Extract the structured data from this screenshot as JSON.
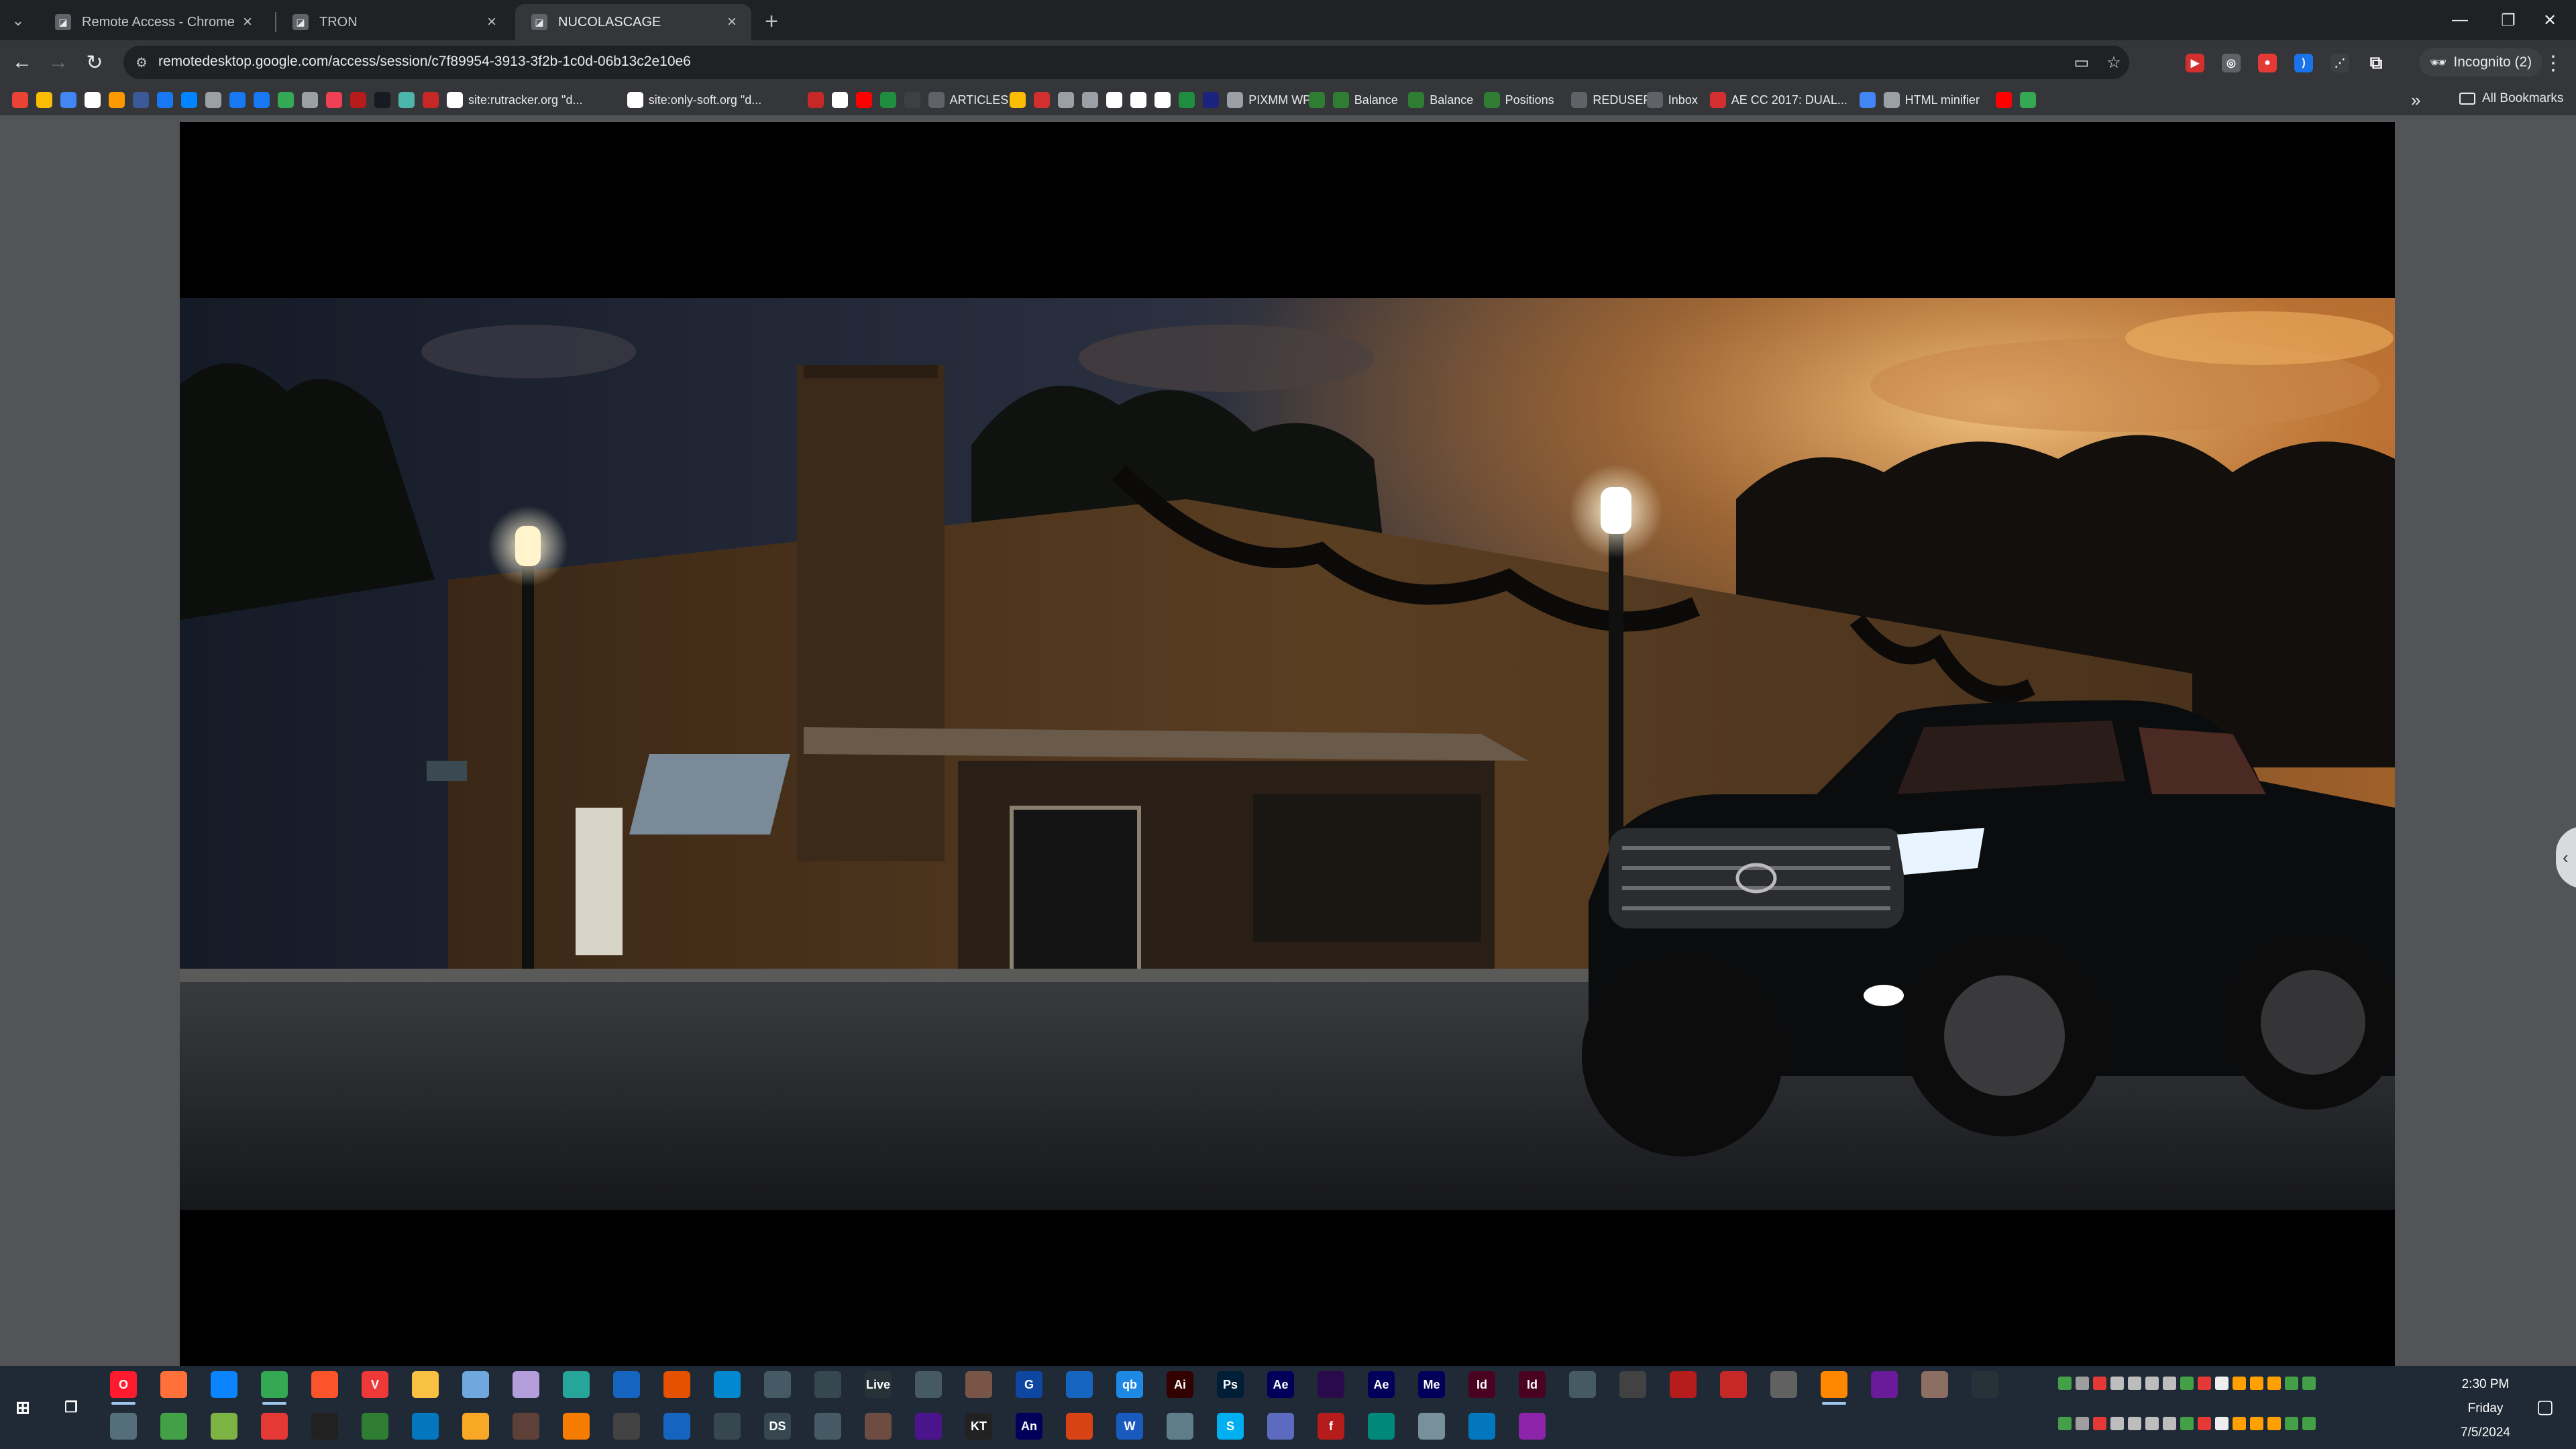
{
  "browser": {
    "tabs": [
      {
        "title": "Remote Access - Chrome Remo",
        "active": false
      },
      {
        "title": "TRON",
        "active": false
      },
      {
        "title": "NUCOLASCAGE",
        "active": true
      }
    ],
    "url": "remotedesktop.google.com/access/session/c7f89954-3913-3f2b-1c0d-06b13c2e10e6",
    "incognito_label": "Incognito (2)",
    "bookmarks": [
      {
        "icon": "gmail-icon",
        "label": "",
        "color": "#ea4335"
      },
      {
        "icon": "apps-icon",
        "label": "",
        "color": "#fbbc04"
      },
      {
        "icon": "globe-icon",
        "label": "",
        "color": "#4285f4"
      },
      {
        "icon": "amazon-icon",
        "label": "",
        "color": "#ffffff"
      },
      {
        "icon": "amazon-icon",
        "label": "",
        "color": "#ff9900"
      },
      {
        "icon": "h-icon",
        "label": "",
        "color": "#3b5998"
      },
      {
        "icon": "facebook-icon",
        "label": "",
        "color": "#1877f2"
      },
      {
        "icon": "messenger-icon",
        "label": "",
        "color": "#0084ff"
      },
      {
        "icon": "page-icon",
        "label": "",
        "color": "#9aa0a6"
      },
      {
        "icon": "facebook-icon",
        "label": "",
        "color": "#1877f2"
      },
      {
        "icon": "facebook-icon",
        "label": "",
        "color": "#1877f2"
      },
      {
        "icon": "chrome-icon",
        "label": "",
        "color": "#34a853"
      },
      {
        "icon": "globe-icon",
        "label": "",
        "color": "#9aa0a6"
      },
      {
        "icon": "pocket-icon",
        "label": "",
        "color": "#ef4056"
      },
      {
        "icon": "red-icon",
        "label": "",
        "color": "#b71c1c"
      },
      {
        "icon": "steam-icon",
        "label": "",
        "color": "#171a21"
      },
      {
        "icon": "circle-icon",
        "label": "",
        "color": "#4db6ac"
      },
      {
        "icon": "red-icon",
        "label": "",
        "color": "#c62828"
      },
      {
        "icon": "google-icon",
        "label": "site:rutracker.org \"d...",
        "color": "#ffffff"
      },
      {
        "icon": "google-icon",
        "label": "site:only-soft.org \"d...",
        "color": "#ffffff"
      },
      {
        "icon": "red-icon",
        "label": "",
        "color": "#c62828"
      },
      {
        "icon": "google-icon",
        "label": "",
        "color": "#ffffff"
      },
      {
        "icon": "youtube-icon",
        "label": "",
        "color": "#ff0000"
      },
      {
        "icon": "fl-icon",
        "label": "",
        "color": "#1e8e3e"
      },
      {
        "icon": "i-icon",
        "label": "",
        "color": "#3c4043"
      },
      {
        "icon": "articles-icon",
        "label": "ARTICLES",
        "color": "#5f6368"
      },
      {
        "icon": "color-icon",
        "label": "",
        "color": "#fbbc04"
      },
      {
        "icon": "n-icon",
        "label": "",
        "color": "#d32f2f"
      },
      {
        "icon": "page-icon",
        "label": "",
        "color": "#9aa0a6"
      },
      {
        "icon": "page-icon",
        "label": "",
        "color": "#9aa0a6"
      },
      {
        "icon": "google-icon",
        "label": "",
        "color": "#ffffff"
      },
      {
        "icon": "google-icon",
        "label": "",
        "color": "#ffffff"
      },
      {
        "icon": "google-icon",
        "label": "",
        "color": "#ffffff"
      },
      {
        "icon": "green-icon",
        "label": "",
        "color": "#1e8e3e"
      },
      {
        "icon": "ha-icon",
        "label": "",
        "color": "#1a237e"
      },
      {
        "icon": "globe-icon",
        "label": "PIXMM WP",
        "color": "#9aa0a6"
      },
      {
        "icon": "td-icon",
        "label": "",
        "color": "#2e7d32"
      },
      {
        "icon": "td-icon",
        "label": "Balance",
        "color": "#2e7d32"
      },
      {
        "icon": "td-icon",
        "label": "Balance",
        "color": "#2e7d32"
      },
      {
        "icon": "td-icon",
        "label": "Positions",
        "color": "#2e7d32"
      },
      {
        "icon": "page-icon",
        "label": "REDUSER",
        "color": "#5f6368"
      },
      {
        "icon": "page-icon",
        "label": "Inbox",
        "color": "#5f6368"
      },
      {
        "icon": "adobe-icon",
        "label": "AE CC 2017: DUAL...",
        "color": "#d32f2f"
      },
      {
        "icon": "info-icon",
        "label": "",
        "color": "#4285f4"
      },
      {
        "icon": "globe-icon",
        "label": "HTML minifier",
        "color": "#9aa0a6"
      },
      {
        "icon": "youtube-icon",
        "label": "",
        "color": "#ff0000"
      },
      {
        "icon": "maps-icon",
        "label": "",
        "color": "#34a853"
      }
    ],
    "all_bookmarks_label": "All Bookmarks"
  },
  "taskbar": {
    "time": "2:30 PM",
    "day": "Friday",
    "date": "7/5/2024",
    "row1_apps": [
      {
        "name": "opera",
        "label": "O",
        "color": "#ff1b2d"
      },
      {
        "name": "firefox",
        "label": "",
        "color": "#ff7139"
      },
      {
        "name": "firefox-dev",
        "label": "",
        "color": "#0a84ff"
      },
      {
        "name": "chrome",
        "label": "",
        "color": "#34a853"
      },
      {
        "name": "brave",
        "label": "",
        "color": "#fb542b"
      },
      {
        "name": "vivaldi",
        "label": "V",
        "color": "#ef3939"
      },
      {
        "name": "explorer",
        "label": "",
        "color": "#f8c142"
      },
      {
        "name": "app",
        "label": "",
        "color": "#6fa8dc"
      },
      {
        "name": "app",
        "label": "",
        "color": "#b39ddb"
      },
      {
        "name": "app",
        "label": "",
        "color": "#26a69a"
      },
      {
        "name": "app",
        "label": "",
        "color": "#1565c0"
      },
      {
        "name": "app",
        "label": "",
        "color": "#e65100"
      },
      {
        "name": "app",
        "label": "",
        "color": "#0288d1"
      },
      {
        "name": "app",
        "label": "",
        "color": "#455a64"
      },
      {
        "name": "app",
        "label": "",
        "color": "#37474f"
      },
      {
        "name": "live",
        "label": "Live",
        "color": "#263238"
      },
      {
        "name": "app",
        "label": "",
        "color": "#455a64"
      },
      {
        "name": "app",
        "label": "",
        "color": "#795548"
      },
      {
        "name": "app",
        "label": "G",
        "color": "#0d47a1"
      },
      {
        "name": "app",
        "label": "",
        "color": "#1565c0"
      },
      {
        "name": "qbittorrent",
        "label": "qb",
        "color": "#1e88e5"
      },
      {
        "name": "illustrator",
        "label": "Ai",
        "color": "#330000"
      },
      {
        "name": "photoshop",
        "label": "Ps",
        "color": "#001e36"
      },
      {
        "name": "after-effects",
        "label": "Ae",
        "color": "#00005b"
      },
      {
        "name": "premiere",
        "label": "",
        "color": "#2a0a4a"
      },
      {
        "name": "after-effects",
        "label": "Ae",
        "color": "#00005b"
      },
      {
        "name": "media-encoder",
        "label": "Me",
        "color": "#00005b"
      },
      {
        "name": "indesign",
        "label": "Id",
        "color": "#49021f"
      },
      {
        "name": "indesign",
        "label": "Id",
        "color": "#49021f"
      },
      {
        "name": "davinci",
        "label": "",
        "color": "#455a64"
      },
      {
        "name": "app",
        "label": "",
        "color": "#424242"
      },
      {
        "name": "app",
        "label": "",
        "color": "#b71c1c"
      },
      {
        "name": "app",
        "label": "",
        "color": "#c62828"
      },
      {
        "name": "app",
        "label": "",
        "color": "#616161"
      },
      {
        "name": "vlc",
        "label": "",
        "color": "#ff8800"
      },
      {
        "name": "app",
        "label": "",
        "color": "#6a1b9a"
      },
      {
        "name": "app",
        "label": "",
        "color": "#8d6e63"
      },
      {
        "name": "terminal",
        "label": "",
        "color": "#263238"
      }
    ],
    "row2_apps": [
      {
        "name": "calculator",
        "label": "",
        "color": "#546e7a"
      },
      {
        "name": "app",
        "label": "",
        "color": "#43a047"
      },
      {
        "name": "app",
        "label": "",
        "color": "#7cb342"
      },
      {
        "name": "app",
        "label": "",
        "color": "#e53935"
      },
      {
        "name": "app",
        "label": "",
        "color": "#212121"
      },
      {
        "name": "app",
        "label": "",
        "color": "#2e7d32"
      },
      {
        "name": "app",
        "label": "",
        "color": "#0277bd"
      },
      {
        "name": "folder",
        "label": "",
        "color": "#f9a825"
      },
      {
        "name": "app",
        "label": "",
        "color": "#5d4037"
      },
      {
        "name": "app",
        "label": "",
        "color": "#f57c00"
      },
      {
        "name": "settings",
        "label": "",
        "color": "#424242"
      },
      {
        "name": "app",
        "label": "",
        "color": "#1565c0"
      },
      {
        "name": "search",
        "label": "",
        "color": "#37474f"
      },
      {
        "name": "ds",
        "label": "DS",
        "color": "#37474f"
      },
      {
        "name": "app",
        "label": "",
        "color": "#455a64"
      },
      {
        "name": "app",
        "label": "",
        "color": "#6d4c41"
      },
      {
        "name": "app",
        "label": "",
        "color": "#4a148c"
      },
      {
        "name": "app",
        "label": "KT",
        "color": "#212121"
      },
      {
        "name": "animate",
        "label": "An",
        "color": "#00005b"
      },
      {
        "name": "office",
        "label": "",
        "color": "#d84315"
      },
      {
        "name": "word",
        "label": "W",
        "color": "#185abd"
      },
      {
        "name": "app",
        "label": "",
        "color": "#607d8b"
      },
      {
        "name": "skype",
        "label": "S",
        "color": "#00aff0"
      },
      {
        "name": "app",
        "label": "",
        "color": "#5c6bc0"
      },
      {
        "name": "flash",
        "label": "f",
        "color": "#b71c1c"
      },
      {
        "name": "app",
        "label": "",
        "color": "#00897b"
      },
      {
        "name": "app",
        "label": "",
        "color": "#78909c"
      },
      {
        "name": "photos",
        "label": "",
        "color": "#0277bd"
      },
      {
        "name": "app",
        "label": "",
        "color": "#8e24aa"
      }
    ]
  }
}
